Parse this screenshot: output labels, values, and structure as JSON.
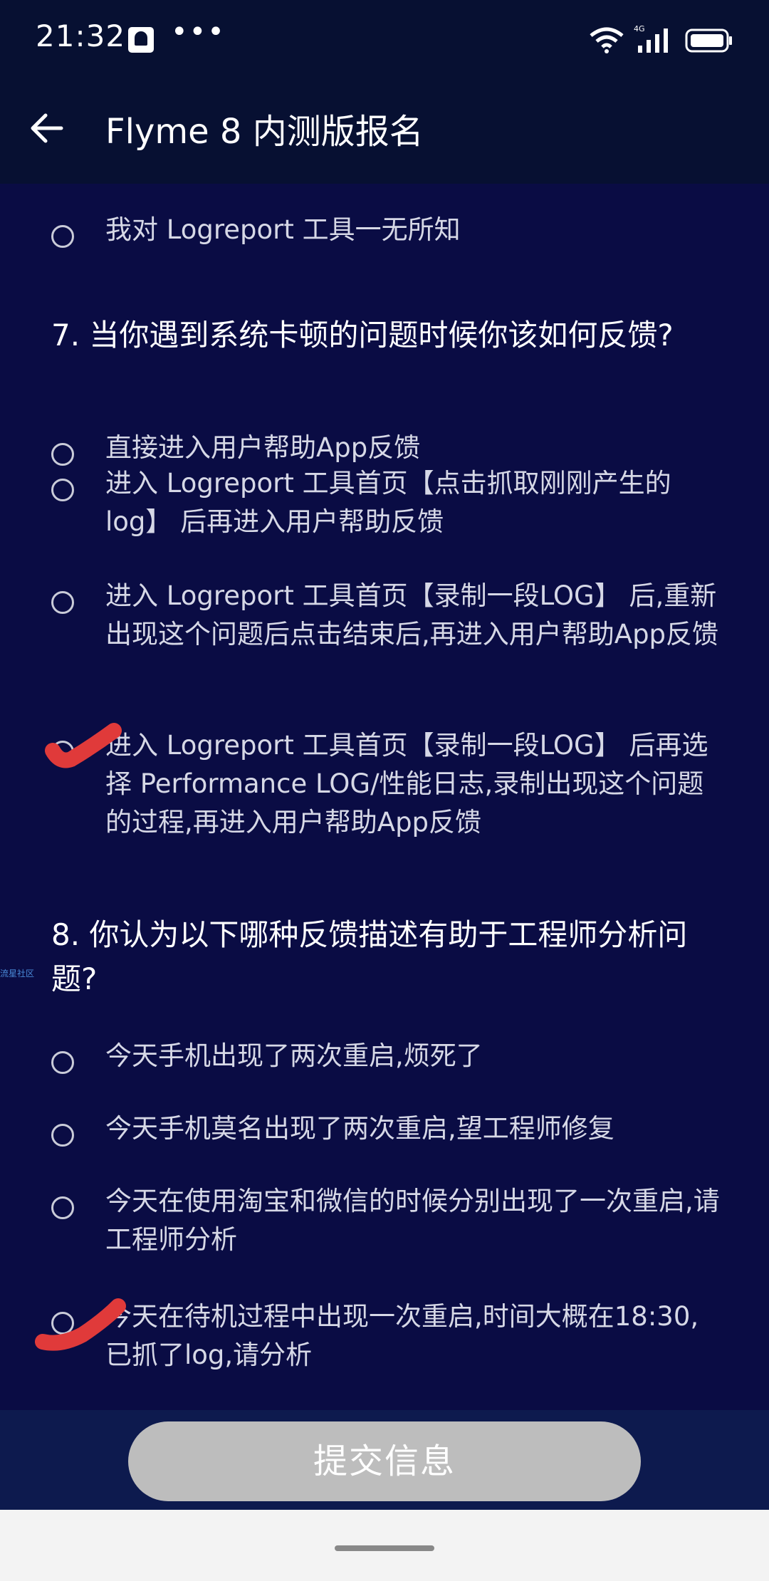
{
  "status_bar": {
    "time": "21:32",
    "more": "•••",
    "network": "4G"
  },
  "header": {
    "title": "Flyme 8 内测版报名"
  },
  "q6": {
    "last_option": "我对 Logreport 工具一无所知"
  },
  "q7": {
    "title": "7. 当你遇到系统卡顿的问题时候你该如何反馈?",
    "options": [
      "直接进入用户帮助App反馈",
      "进入 Logreport 工具首页【点击抓取刚刚产生的log】 后再进入用户帮助反馈",
      "进入 Logreport 工具首页【录制一段LOG】 后,重新出现这个问题后点击结束后,再进入用户帮助App反馈",
      "进入 Logreport 工具首页【录制一段LOG】 后再选择 Performance LOG/性能日志,录制出现这个问题的过程,再进入用户帮助App反馈"
    ]
  },
  "q8": {
    "title": "8. 你认为以下哪种反馈描述有助于工程师分析问题?",
    "options": [
      "今天手机出现了两次重启,烦死了",
      "今天手机莫名出现了两次重启,望工程师修复",
      "今天在使用淘宝和微信的时候分别出现了一次重启,请工程师分析",
      "今天在待机过程中出现一次重启,时间大概在18:30,已抓了log,请分析"
    ]
  },
  "watermark": "流星社区",
  "submit": {
    "label": "提交信息"
  },
  "colors": {
    "background": "#0a0c44",
    "header": "#071032",
    "annotation_mark": "#e03a3a",
    "submit_disabled": "#bdbdbd"
  },
  "icons": {
    "back": "arrow-left-icon",
    "wifi": "wifi-icon",
    "signal": "signal-icon",
    "battery": "battery-icon"
  }
}
